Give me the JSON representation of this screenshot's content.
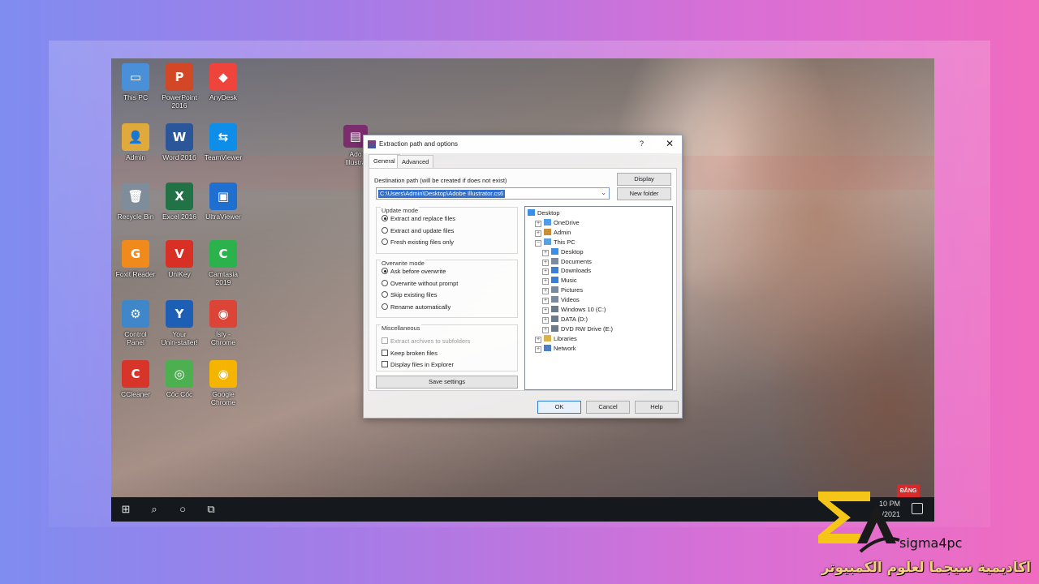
{
  "desktop": {
    "icons": [
      {
        "label": "This PC",
        "glyph": "▭",
        "color": "#4a90d9"
      },
      {
        "label": "PowerPoint\n2016",
        "glyph": "P",
        "color": "#d24726"
      },
      {
        "label": "AnyDesk",
        "glyph": "◆",
        "color": "#ef443b"
      },
      {
        "label": "Admin",
        "glyph": "👤",
        "color": "#e0a93b"
      },
      {
        "label": "Word 2016",
        "glyph": "W",
        "color": "#2b579a"
      },
      {
        "label": "TeamViewer",
        "glyph": "⇆",
        "color": "#0e8ee9"
      },
      {
        "label": "Recycle Bin",
        "glyph": "🗑",
        "color": "#7f8c9a"
      },
      {
        "label": "Excel 2016",
        "glyph": "X",
        "color": "#217346"
      },
      {
        "label": "UltraViewer",
        "glyph": "▣",
        "color": "#1f6fd1"
      },
      {
        "label": "Foxit Reader",
        "glyph": "G",
        "color": "#f08a1c"
      },
      {
        "label": "UniKey",
        "glyph": "V",
        "color": "#d93025"
      },
      {
        "label": "Camtasia\n2019",
        "glyph": "C",
        "color": "#2bb24c"
      },
      {
        "label": "Control\nPanel",
        "glyph": "⚙",
        "color": "#3f87c9"
      },
      {
        "label": "Your\nUnin-staller!",
        "glyph": "Y",
        "color": "#1d5fb5"
      },
      {
        "label": "Ísly -\nChrome",
        "glyph": "◉",
        "color": "#db4437"
      },
      {
        "label": "CCleaner",
        "glyph": "C",
        "color": "#d8352a"
      },
      {
        "label": "Cốc Cốc",
        "glyph": "◎",
        "color": "#4caf50"
      },
      {
        "label": "Google\nChrome",
        "glyph": "◉",
        "color": "#f4b400"
      }
    ],
    "stray_icon_label": "Ado\nIllustra"
  },
  "dialog": {
    "title": "Extraction path and options",
    "help_glyph": "?",
    "close_glyph": "✕",
    "tabs": [
      {
        "label": "General"
      },
      {
        "label": "Advanced"
      }
    ],
    "destination_label": "Destination path (will be created if does not exist)",
    "destination_value": "C:\\Users\\Admin\\Desktop\\Adobe Illustrator.cs6",
    "display_button": "Display",
    "new_folder_button": "New folder",
    "update_mode": {
      "title": "Update mode",
      "options": [
        "Extract and replace files",
        "Extract and update files",
        "Fresh existing files only"
      ],
      "selected": 0
    },
    "overwrite_mode": {
      "title": "Overwrite mode",
      "options": [
        "Ask before overwrite",
        "Overwrite without prompt",
        "Skip existing files",
        "Rename automatically"
      ],
      "selected": 0
    },
    "miscellaneous": {
      "title": "Miscellaneous",
      "options": [
        {
          "label": "Extract archives to subfolders",
          "checked": false,
          "disabled": true
        },
        {
          "label": "Keep broken files",
          "checked": false,
          "disabled": false
        },
        {
          "label": "Display files in Explorer",
          "checked": false,
          "disabled": false
        }
      ]
    },
    "save_settings_button": "Save settings",
    "tree": [
      {
        "label": "Desktop",
        "level": 0,
        "expander": "",
        "icon_color": "#3a8ee6"
      },
      {
        "label": "OneDrive",
        "level": 1,
        "expander": "+",
        "icon_color": "#4f9de6"
      },
      {
        "label": "Admin",
        "level": 1,
        "expander": "+",
        "icon_color": "#c98e3a"
      },
      {
        "label": "This PC",
        "level": 1,
        "expander": "−",
        "icon_color": "#5aa0e0"
      },
      {
        "label": "Desktop",
        "level": 2,
        "expander": "+",
        "icon_color": "#3a8ee6"
      },
      {
        "label": "Documents",
        "level": 2,
        "expander": "+",
        "icon_color": "#7a8aa0"
      },
      {
        "label": "Downloads",
        "level": 2,
        "expander": "+",
        "icon_color": "#3a7ed6"
      },
      {
        "label": "Music",
        "level": 2,
        "expander": "+",
        "icon_color": "#3a7ed6"
      },
      {
        "label": "Pictures",
        "level": 2,
        "expander": "+",
        "icon_color": "#7a8aa0"
      },
      {
        "label": "Videos",
        "level": 2,
        "expander": "+",
        "icon_color": "#7a8aa0"
      },
      {
        "label": "Windows 10 (C:)",
        "level": 2,
        "expander": "+",
        "icon_color": "#6b7b8c"
      },
      {
        "label": "DATA (D:)",
        "level": 2,
        "expander": "+",
        "icon_color": "#6b7b8c"
      },
      {
        "label": "DVD RW Drive (E:)",
        "level": 2,
        "expander": "+",
        "icon_color": "#6b7b8c"
      },
      {
        "label": "Libraries",
        "level": 1,
        "expander": "+",
        "icon_color": "#d9b24a"
      },
      {
        "label": "Network",
        "level": 1,
        "expander": "+",
        "icon_color": "#4a7fc0"
      }
    ],
    "ok_button": "OK",
    "cancel_button": "Cancel",
    "help_button": "Help"
  },
  "taskbar": {
    "start_glyph": "⊞",
    "search_glyph": "⌕",
    "cortana_glyph": "○",
    "taskview_glyph": "⧉",
    "time": "10 PM",
    "date": "/2021",
    "badge": "ĐĂNG"
  },
  "brand": {
    "name": "sigma4pc",
    "tagline": "اكاديمية سيجما لعلوم الكمبيوتر",
    "accent": "#f5c518"
  }
}
